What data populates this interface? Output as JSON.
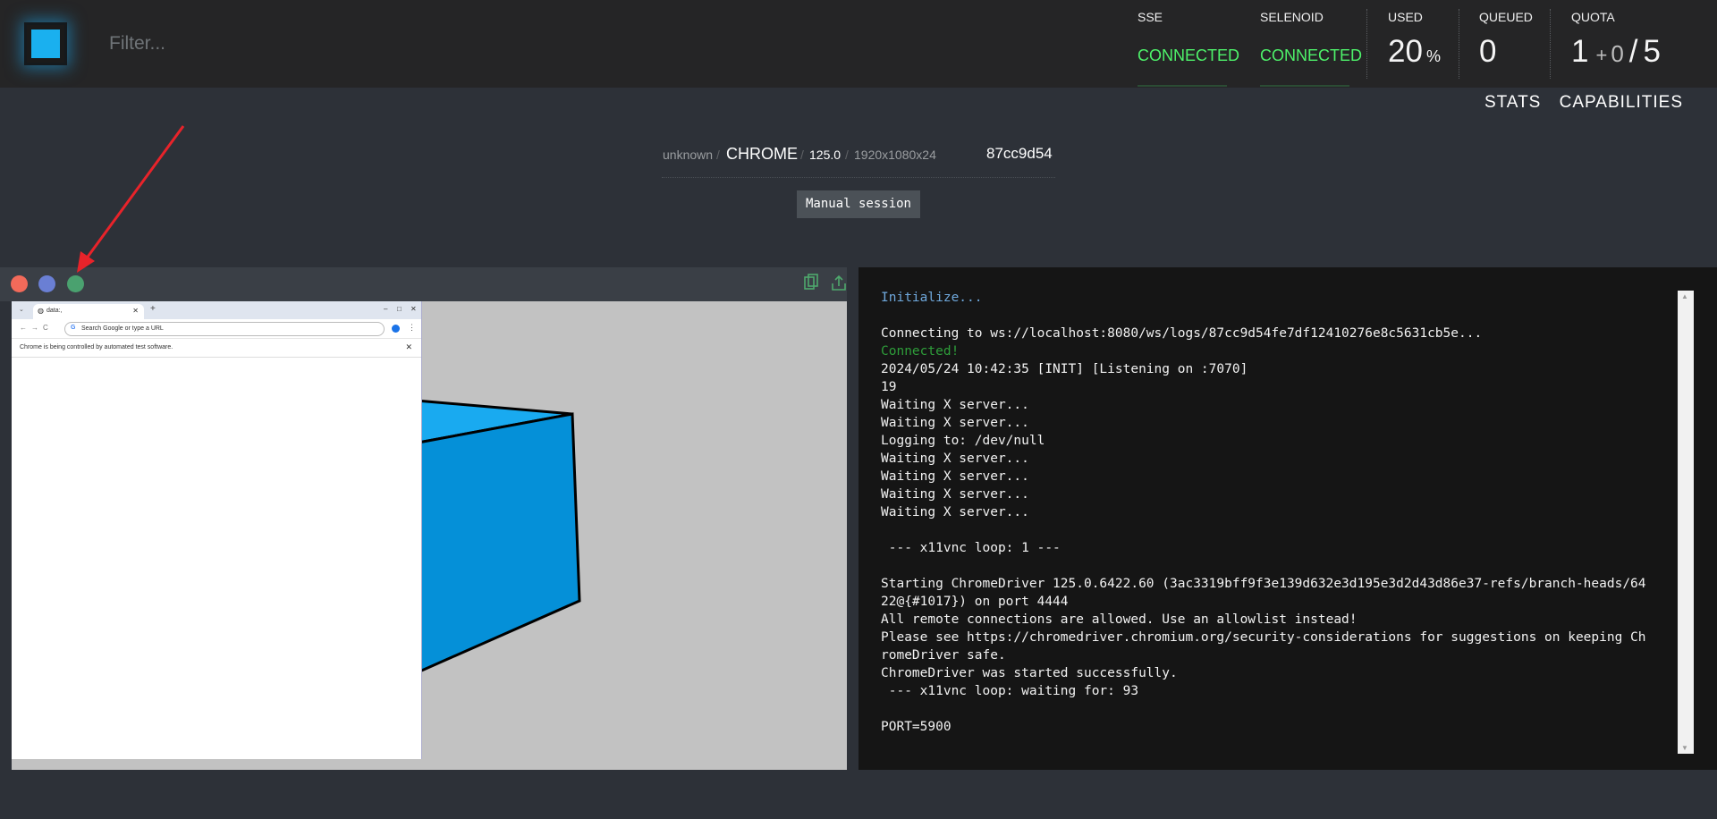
{
  "header": {
    "filter_placeholder": "Filter...",
    "sse": {
      "label": "SSE",
      "status": "CONNECTED"
    },
    "selenoid": {
      "label": "SELENOID",
      "status": "CONNECTED"
    },
    "used": {
      "label": "USED",
      "value": "20",
      "unit": "%"
    },
    "queued": {
      "label": "QUEUED",
      "value": "0"
    },
    "quota": {
      "label": "QUOTA",
      "used": "1",
      "plus": "+",
      "pending": "0",
      "sep": "/",
      "total": "5"
    },
    "status_color": "#4ef26a",
    "accent": "#1ab0ef"
  },
  "nav": {
    "stats": "STATS",
    "capabilities": "CAPABILITIES"
  },
  "session": {
    "platform": "unknown",
    "browser": "CHROME",
    "version": "125.0",
    "resolution": "1920x1080x24",
    "id": "87cc9d54",
    "manual_label": "Manual session"
  },
  "vnc": {
    "toolbar_icons": [
      "close-dot",
      "minimize-dot",
      "fullscreen-dot",
      "copy-icon",
      "upload-icon"
    ],
    "chrome": {
      "tab_title": "data:,",
      "omnibox_placeholder": "Search Google or type a URL",
      "info_bar": "Chrome is being controlled by automated test software."
    }
  },
  "log": {
    "init": "Initialize...",
    "connecting": "Connecting to ws://localhost:8080/ws/logs/87cc9d54fe7df12410276e8c5631cb5e...",
    "connected": "Connected!",
    "lines": "2024/05/24 10:42:35 [INIT] [Listening on :7070]\n19\nWaiting X server...\nWaiting X server...\nLogging to: /dev/null\nWaiting X server...\nWaiting X server...\nWaiting X server...\nWaiting X server...\n\n --- x11vnc loop: 1 ---\n\nStarting ChromeDriver 125.0.6422.60 (3ac3319bff9f3e139d632e3d195e3d2d43d86e37-refs/branch-heads/64\n22@{#1017}) on port 4444\nAll remote connections are allowed. Use an allowlist instead!\nPlease see https://chromedriver.chromium.org/security-considerations for suggestions on keeping Ch\nromeDriver safe.\nChromeDriver was started successfully.\n --- x11vnc loop: waiting for: 93\n\nPORT=5900"
  }
}
